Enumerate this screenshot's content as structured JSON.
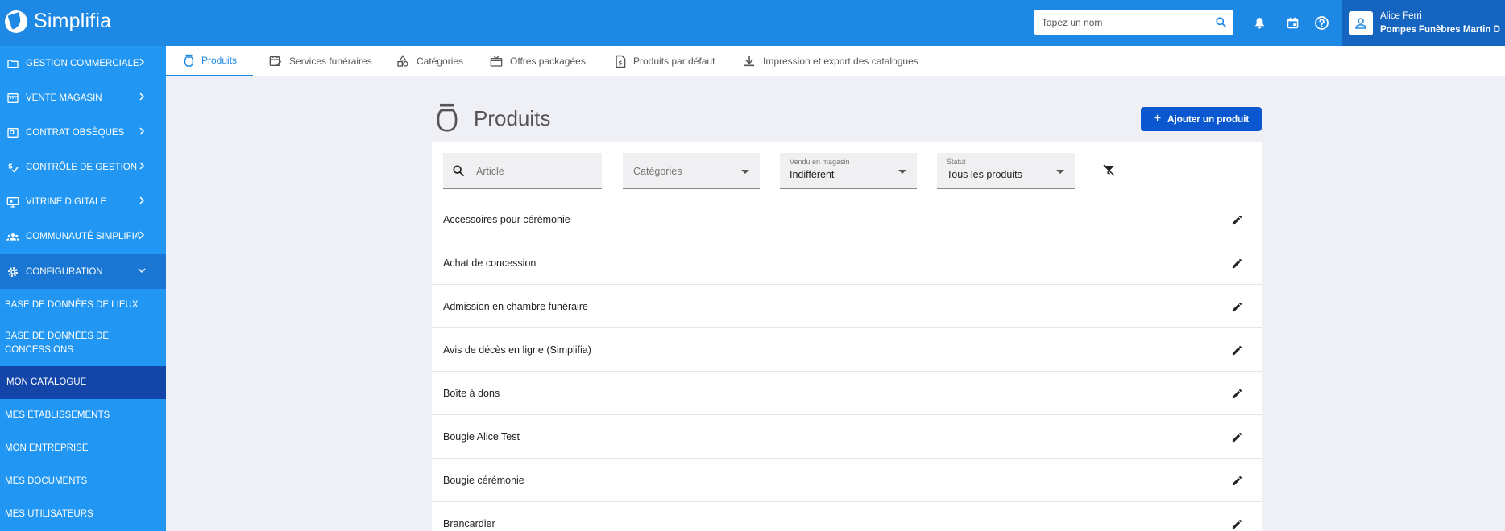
{
  "app": {
    "name": "Simplifia"
  },
  "search": {
    "placeholder": "Tapez un nom"
  },
  "user": {
    "name": "Alice Ferri",
    "company": "Pompes Funèbres Martin D"
  },
  "sidebar": {
    "groups": [
      {
        "label": "GESTION COMMERCIALE",
        "icon": "folder-icon"
      },
      {
        "label": "VENTE MAGASIN",
        "icon": "store-icon"
      },
      {
        "label": "CONTRAT OBSÈQUES",
        "icon": "contract-icon"
      },
      {
        "label": "CONTRÔLE DE GESTION",
        "icon": "money-check-icon"
      },
      {
        "label": "VITRINE DIGITALE",
        "icon": "monitor-icon"
      },
      {
        "label": "COMMUNAUTÉ SIMPLIFIA",
        "icon": "community-icon"
      },
      {
        "label": "CONFIGURATION",
        "icon": "settings-gear-icon"
      }
    ],
    "sub_items": [
      {
        "label": "BASE DE DONNÉES DE LIEUX"
      },
      {
        "label": "BASE DE DONNÉES DE CONCESSIONS"
      },
      {
        "label": "MON CATALOGUE"
      },
      {
        "label": "MES ÉTABLISSEMENTS"
      },
      {
        "label": "MON ENTREPRISE"
      },
      {
        "label": "MES DOCUMENTS"
      },
      {
        "label": "MES UTILISATEURS"
      }
    ]
  },
  "tabs": [
    {
      "label": "Produits",
      "icon": "urn-icon"
    },
    {
      "label": "Services funéraires",
      "icon": "calendar-edit-icon"
    },
    {
      "label": "Catégories",
      "icon": "shapes-icon"
    },
    {
      "label": "Offres packagées",
      "icon": "package-icon"
    },
    {
      "label": "Produits par défaut",
      "icon": "invoice-icon"
    },
    {
      "label": "Impression et export des catalogues",
      "icon": "download-icon"
    }
  ],
  "page": {
    "title": "Produits",
    "add_button": "Ajouter un produit"
  },
  "filters": {
    "article_placeholder": "Article",
    "categories_placeholder": "Catégories",
    "sold_in_store_label": "Vendu en magasin",
    "sold_in_store_value": "Indifférent",
    "status_label": "Statut",
    "status_value": "Tous les produits"
  },
  "products": [
    "Accessoires pour cérémonie",
    "Achat de concession",
    "Admission en chambre funéraire",
    "Avis de décès en ligne (Simplifia)",
    "Boîte à dons",
    "Bougie Alice Test",
    "Bougie cérémonie",
    "Brancardier"
  ],
  "colors": {
    "brand_blue": "#1e88e5",
    "sidebar_blue": "#2196f3",
    "selected_blue": "#1346a8",
    "button_blue": "#0b57d0"
  }
}
